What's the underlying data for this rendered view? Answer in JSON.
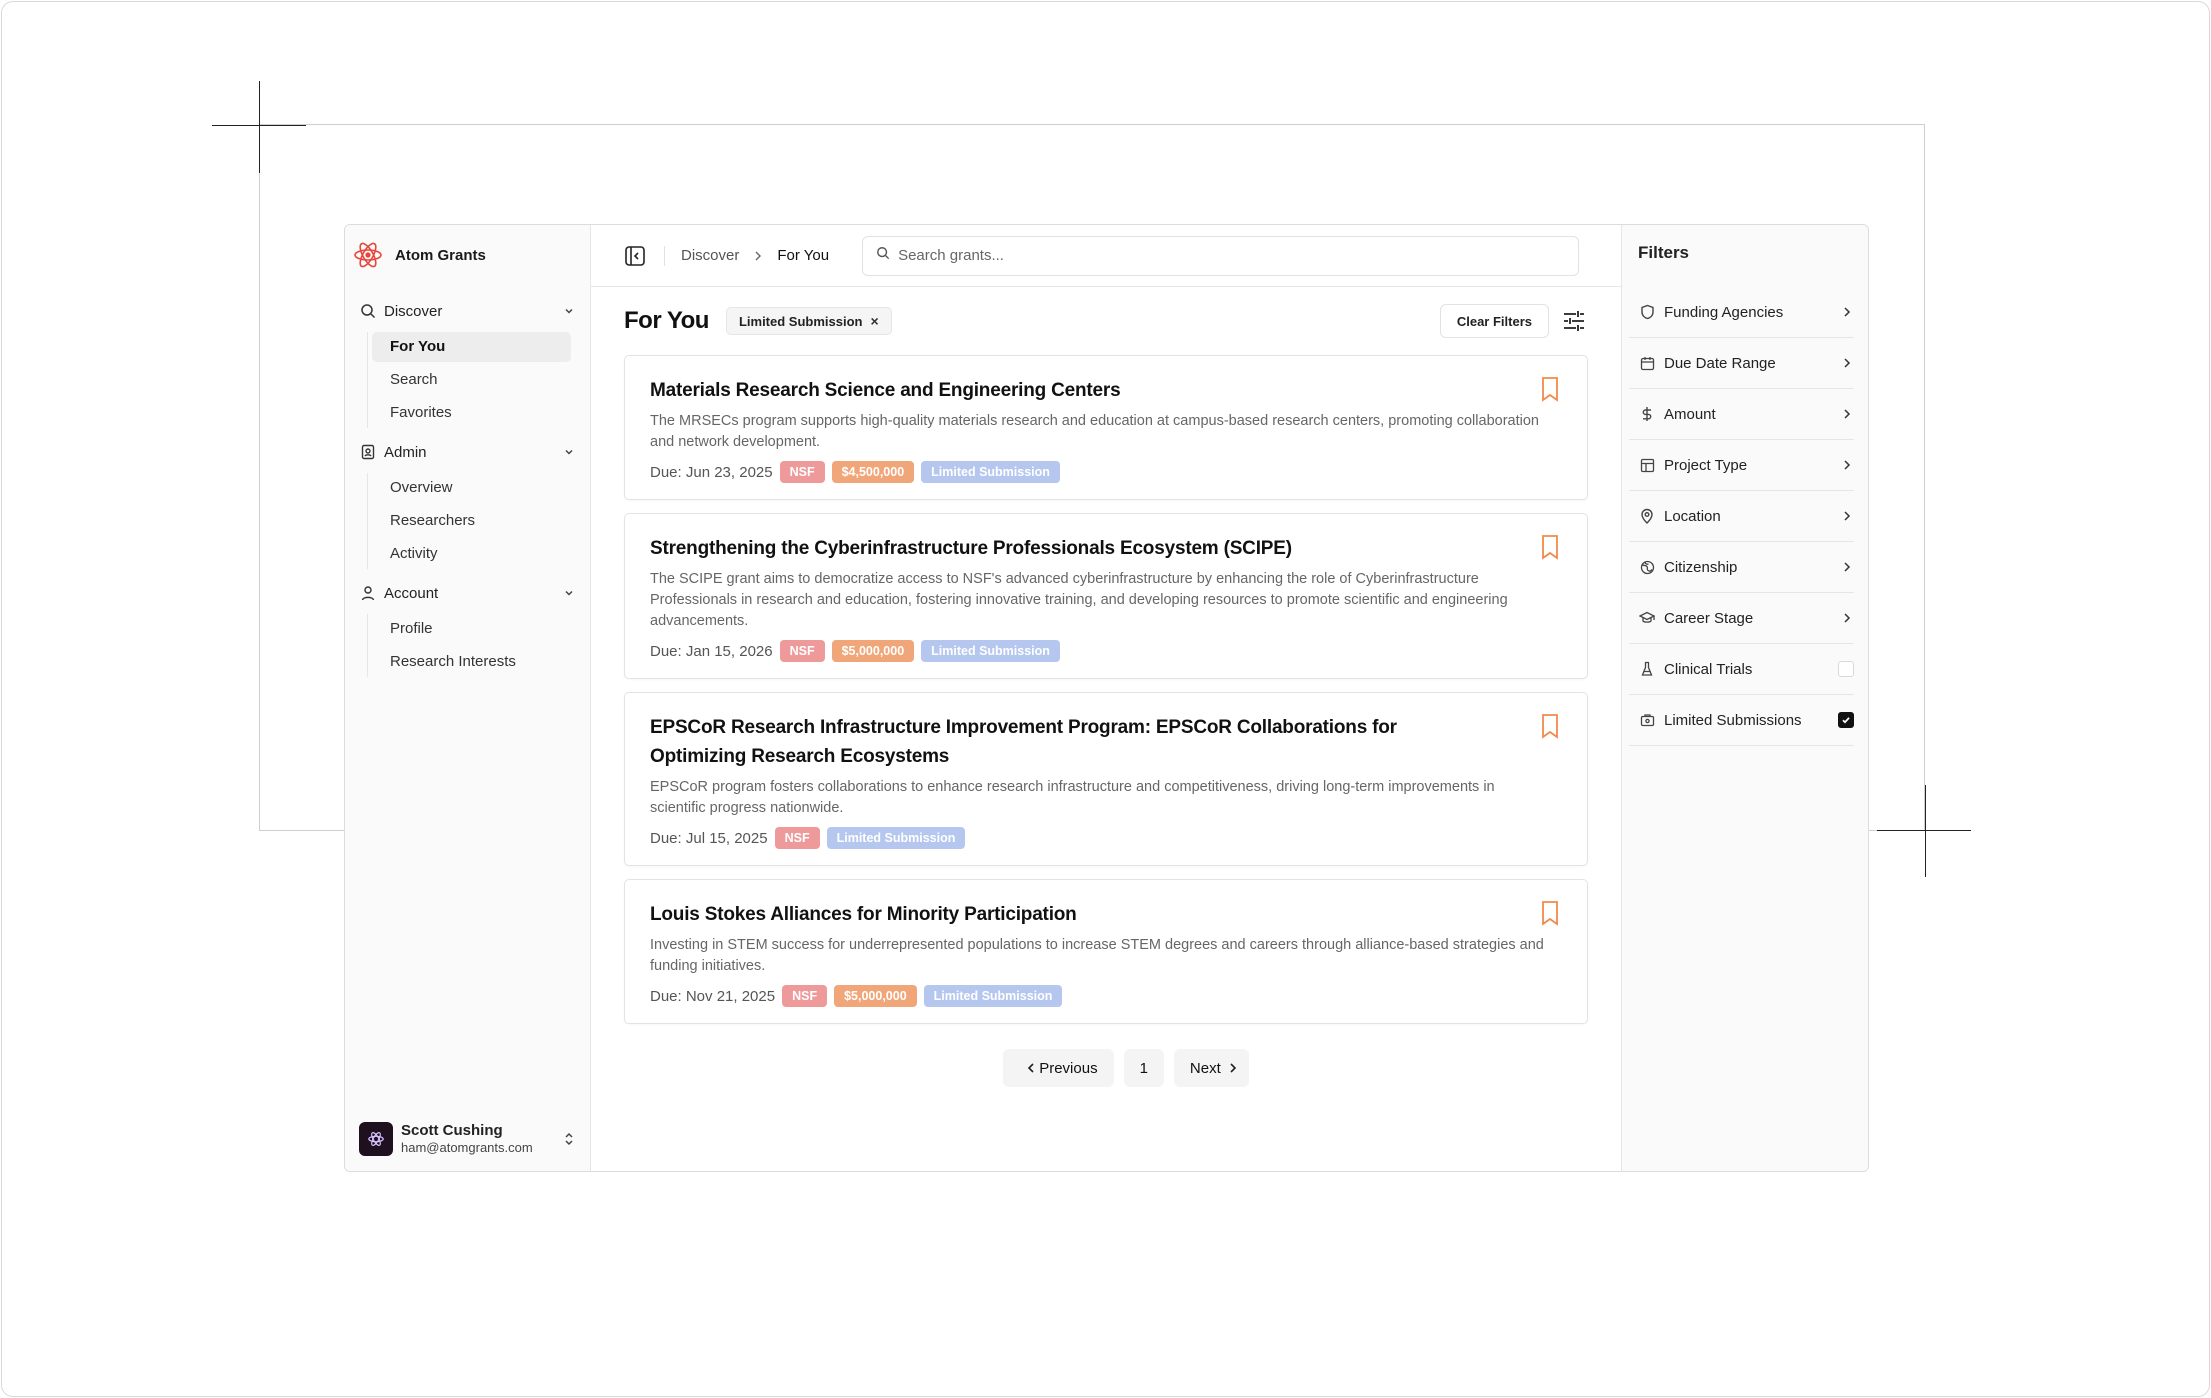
{
  "app": {
    "name": "Atom Grants"
  },
  "sidebar": {
    "groups": [
      {
        "label": "Discover",
        "icon": "search-icon",
        "items": [
          "For You",
          "Search",
          "Favorites"
        ]
      },
      {
        "label": "Admin",
        "icon": "admin-badge-icon",
        "items": [
          "Overview",
          "Researchers",
          "Activity"
        ]
      },
      {
        "label": "Account",
        "icon": "user-icon",
        "items": [
          "Profile",
          "Research Interests"
        ]
      }
    ],
    "active_item": "For You"
  },
  "user": {
    "name": "Scott Cushing",
    "email": "ham@atomgrants.com"
  },
  "topbar": {
    "breadcrumb": [
      "Discover",
      "For You"
    ],
    "search_placeholder": "Search grants..."
  },
  "page": {
    "title": "For You",
    "active_filter_chip": "Limited Submission",
    "clear_filters_label": "Clear Filters"
  },
  "grants": [
    {
      "title": "Materials Research Science and Engineering Centers",
      "description": "The MRSECs program supports high-quality materials research and education at campus-based research centers, promoting collaboration and network development.",
      "due": "Due: Jun 23, 2025",
      "agency": "NSF",
      "amount": "$4,500,000",
      "limited": "Limited Submission"
    },
    {
      "title": "Strengthening the Cyberinfrastructure Professionals Ecosystem (SCIPE)",
      "description": "The SCIPE grant aims to democratize access to NSF's advanced cyberinfrastructure by enhancing the role of Cyberinfrastructure Professionals in research and education, fostering innovative training, and developing resources to promote scientific and engineering advancements.",
      "due": "Due: Jan 15, 2026",
      "agency": "NSF",
      "amount": "$5,000,000",
      "limited": "Limited Submission"
    },
    {
      "title": "EPSCoR Research Infrastructure Improvement Program: EPSCoR Collaborations for Optimizing Research Ecosystems",
      "description": "EPSCoR program fosters collaborations to enhance research infrastructure and competitiveness, driving long-term improvements in scientific progress nationwide.",
      "due": "Due: Jul 15, 2025",
      "agency": "NSF",
      "amount": "",
      "limited": "Limited Submission"
    },
    {
      "title": "Louis Stokes Alliances for Minority Participation",
      "description": "Investing in STEM success for underrepresented populations to increase STEM degrees and careers through alliance-based strategies and funding initiatives.",
      "due": "Due: Nov 21, 2025",
      "agency": "NSF",
      "amount": "$5,000,000",
      "limited": "Limited Submission"
    }
  ],
  "pagination": {
    "previous": "Previous",
    "page": "1",
    "next": "Next"
  },
  "filters": {
    "title": "Filters",
    "items": [
      {
        "label": "Funding Agencies",
        "icon": "shield-icon",
        "control": "chevron"
      },
      {
        "label": "Due Date Range",
        "icon": "calendar-icon",
        "control": "chevron"
      },
      {
        "label": "Amount",
        "icon": "dollar-icon",
        "control": "chevron"
      },
      {
        "label": "Project Type",
        "icon": "layout-icon",
        "control": "chevron"
      },
      {
        "label": "Location",
        "icon": "map-pin-icon",
        "control": "chevron"
      },
      {
        "label": "Citizenship",
        "icon": "globe-icon",
        "control": "chevron"
      },
      {
        "label": "Career Stage",
        "icon": "graduation-cap-icon",
        "control": "chevron"
      },
      {
        "label": "Clinical Trials",
        "icon": "flask-icon",
        "control": "checkbox",
        "checked": false
      },
      {
        "label": "Limited Submissions",
        "icon": "briefcase-icon",
        "control": "checkbox",
        "checked": true
      }
    ]
  },
  "colors": {
    "agency_tag": "#ee9a9a",
    "amount_tag": "#f1a67a",
    "limited_tag": "#b5c7ef",
    "bookmark": "#f08a4b",
    "brand_logo": "#e8463a"
  }
}
